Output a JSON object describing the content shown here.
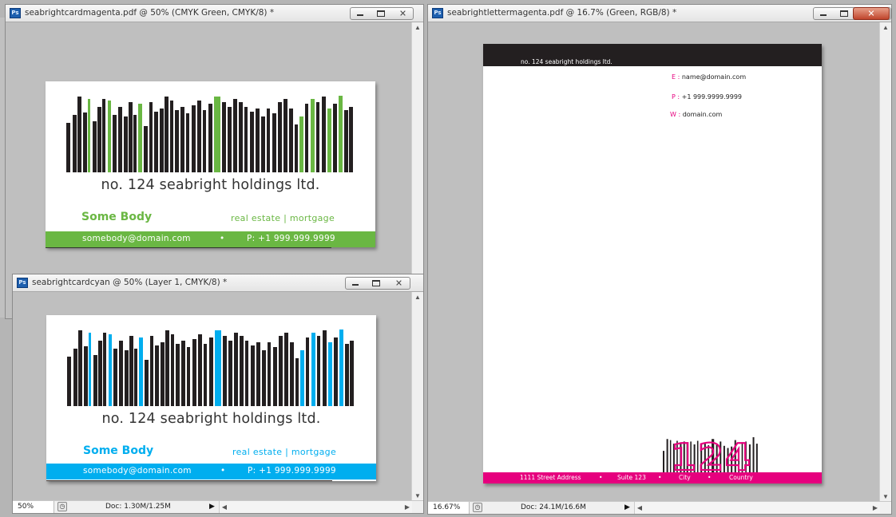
{
  "windows": {
    "card_magenta": {
      "title": "seabrightcardmagenta.pdf @ 50% (CMYK Green, CMYK/8) *"
    },
    "card_cyan": {
      "title": "seabrightcardcyan @ 50% (Layer 1, CMYK/8) *",
      "zoom": "50%",
      "doc": "Doc: 1.30M/1.25M"
    },
    "letter": {
      "title": "seabrightlettermagenta.pdf @ 16.7% (Green, RGB/8) *",
      "zoom": "16.67%",
      "doc": "Doc: 24.1M/16.6M"
    }
  },
  "ps_icon": "Ps",
  "icons": {
    "minimize": "minimize-icon",
    "maximize": "maximize-icon",
    "close": "close-icon",
    "glyph_close": "✕"
  },
  "card": {
    "company": "no. 124 seabright holdings ltd.",
    "person": "Some Body",
    "trade": "real estate | mortgage",
    "email": "somebody@domain.com",
    "bullet": "•",
    "phone": "P: +1 999.999.9999"
  },
  "colors": {
    "green": "#6ab743",
    "cyan": "#00aeef",
    "magenta": "#e6007e",
    "dark": "#231f20"
  },
  "letter": {
    "header": "no. 124 seabright holdings ltd.",
    "contacts": [
      {
        "key": "E :",
        "value": "name@domain.com"
      },
      {
        "key": "P :",
        "value": "+1 999.9999.9999"
      },
      {
        "key": "W :",
        "value": "domain.com"
      }
    ],
    "footer": [
      "1111 Street Address",
      "•",
      "Suite 123",
      "•",
      "City",
      "•",
      "Country"
    ]
  }
}
